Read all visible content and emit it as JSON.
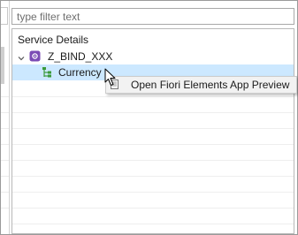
{
  "filter": {
    "placeholder": "type filter text",
    "value": ""
  },
  "tree": {
    "header": "Service Details",
    "service": {
      "label": "Z_BIND_XXX",
      "expanded": true,
      "icon": "service-icon"
    },
    "entity": {
      "label": "Currency",
      "selected": true,
      "icon": "entity-set-icon"
    }
  },
  "context_menu": {
    "items": [
      {
        "label": "Open Fiori Elements App Preview",
        "icon": "preview-icon"
      }
    ]
  },
  "colors": {
    "selection": "#cce8ff",
    "service_icon": "#7b4bb5",
    "entity_icon": "#3a9a3a"
  }
}
